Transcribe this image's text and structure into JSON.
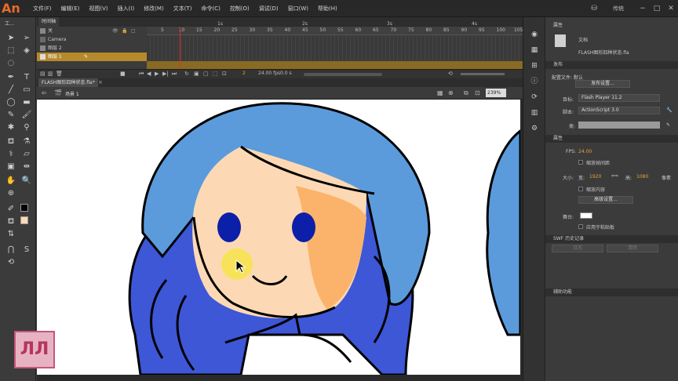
{
  "app": {
    "logo": "An",
    "menus": [
      "文件(F)",
      "编辑(E)",
      "视图(V)",
      "插入(I)",
      "修改(M)",
      "文本(T)",
      "命令(C)",
      "控制(O)",
      "调试(D)",
      "窗口(W)",
      "帮助(H)"
    ],
    "workspace": "传统",
    "window_buttons": [
      "−",
      "□",
      "✕"
    ]
  },
  "timeline": {
    "tab": "时间轴",
    "layers": [
      {
        "name": "关"
      },
      {
        "name": "Camera"
      },
      {
        "name": "图层 2"
      },
      {
        "name": "图层 1",
        "selected": true
      }
    ],
    "ruler_numbers": [
      "5",
      "10",
      "15",
      "20",
      "25",
      "30",
      "35",
      "40",
      "45",
      "50",
      "55",
      "60",
      "65",
      "70",
      "75",
      "80",
      "85",
      "90",
      "95",
      "100",
      "105"
    ],
    "seconds": [
      "1s",
      "2s",
      "3s",
      "4s"
    ],
    "current_frame": "2",
    "fps_display": "24.00 fps",
    "time_display": "0.0 s"
  },
  "document": {
    "tab": "FLASH图形四种状态.fla*",
    "scene": "场景 1",
    "zoom": "239%"
  },
  "properties": {
    "panel_title": "属性",
    "doc_type": "文档",
    "doc_name": "FLASH图形四种状态.fla",
    "publish_section": "发布",
    "profile_label": "配置文件: 默认",
    "publish_settings": "发布设置...",
    "target_label": "目标:",
    "target_value": "Flash Player 11.2",
    "script_label": "脚本:",
    "script_value": "ActionScript 3.0",
    "class_label": "类:",
    "props_section": "属性",
    "fps_label": "FPS:",
    "fps_value": "24.00",
    "scale_spacing": "缩放帧间距",
    "size_label": "大小:",
    "width_label": "宽:",
    "width_value": "1920",
    "height_label": "高:",
    "height_value": "1080",
    "unit": "像素",
    "scale_content": "缩放内容",
    "advanced": "高级设置...",
    "stage_label": "舞台:",
    "paste_board": "应用于粘贴板",
    "swf_section": "SWF 历史记录",
    "log_btn": "日志",
    "clear_btn": "清除",
    "assist_section": "辅助功能"
  },
  "colors": {
    "hair_light": "#5b9bdc",
    "hair_dark": "#3d57d6",
    "skin": "#fcd9b4",
    "skin_shadow": "#fbb36c",
    "eyes": "#0c1fa8",
    "blush": "#f7e34a",
    "accent": "#e8a23a"
  }
}
